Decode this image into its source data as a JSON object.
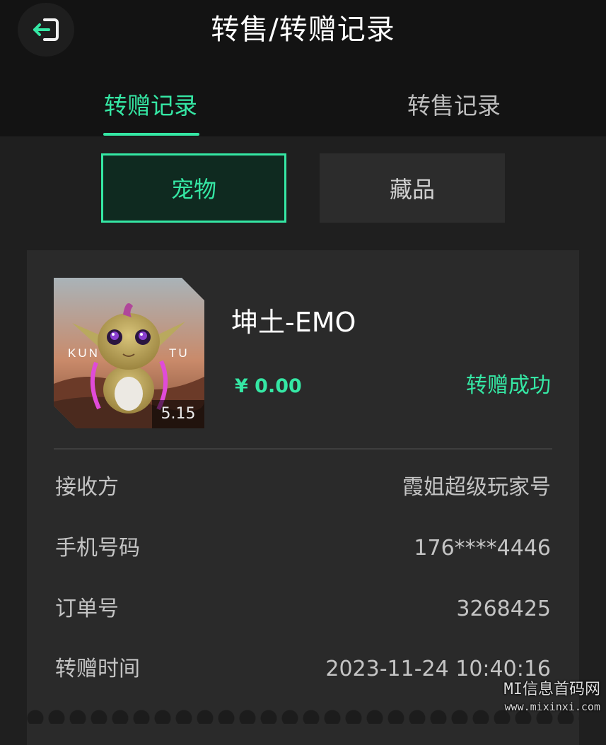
{
  "header": {
    "title": "转售/转赠记录",
    "back_icon": "exit-icon"
  },
  "tabs": [
    {
      "label": "转赠记录",
      "active": true
    },
    {
      "label": "转售记录",
      "active": false
    }
  ],
  "segments": [
    {
      "label": "宠物",
      "active": true
    },
    {
      "label": "藏品",
      "active": false
    }
  ],
  "record": {
    "name": "坤土-EMO",
    "thumb_text_left": "KUN",
    "thumb_text_right": "TU",
    "thumb_badge": "5.15",
    "price": "¥ 0.00",
    "status": "转赠成功",
    "rows": [
      {
        "label": "接收方",
        "value": "霞姐超级玩家号"
      },
      {
        "label": "手机号码",
        "value": "176****4446"
      },
      {
        "label": "订单号",
        "value": "3268425"
      },
      {
        "label": "转赠时间",
        "value": "2023-11-24 10:40:16"
      }
    ]
  },
  "watermark": {
    "line1": "MI信息首码网",
    "line2": "www.mixinxi.com"
  },
  "colors": {
    "accent": "#35e7a4",
    "background": "#1f1f1f",
    "header_bg": "#131313",
    "card_bg": "#2a2a2a"
  }
}
